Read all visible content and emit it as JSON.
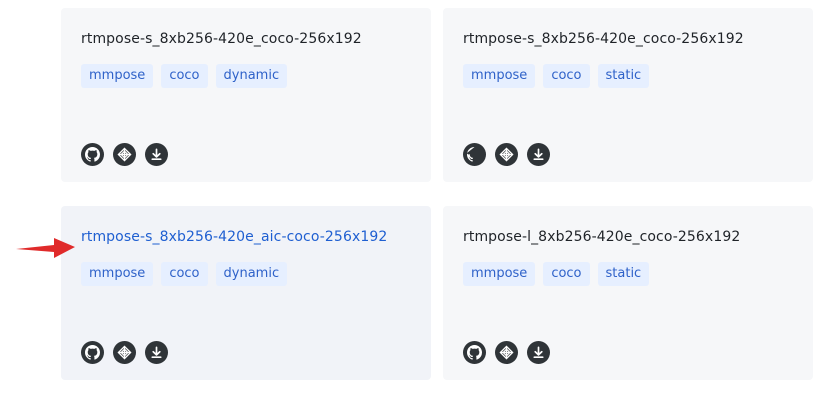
{
  "cards": [
    {
      "title": "rtmpose-s_8xb256-420e_coco-256x192",
      "tags": [
        "mmpose",
        "coco",
        "dynamic"
      ]
    },
    {
      "title": "rtmpose-s_8xb256-420e_coco-256x192",
      "tags": [
        "mmpose",
        "coco",
        "static"
      ]
    },
    {
      "title": "rtmpose-s_8xb256-420e_aic-coco-256x192",
      "tags": [
        "mmpose",
        "coco",
        "dynamic"
      ]
    },
    {
      "title": "rtmpose-l_8xb256-420e_coco-256x192",
      "tags": [
        "mmpose",
        "coco",
        "static"
      ]
    }
  ],
  "icons": [
    "github-icon",
    "openmmlab-icon",
    "download-icon"
  ],
  "colors": {
    "card_bg": "#f6f7f9",
    "tag_bg": "#e6efff",
    "tag_text": "#2f62c9",
    "link_hover": "#1f5fd1",
    "arrow": "#e02a2a"
  }
}
